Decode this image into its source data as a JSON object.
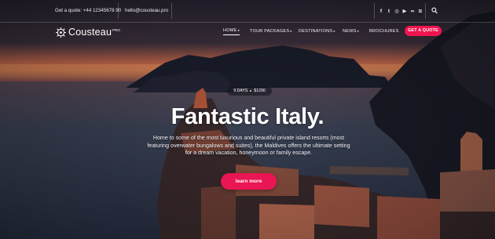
{
  "topbar": {
    "quote_phone": "Get a quote: +44 12345678 90",
    "email": "hello@cousteau.pro",
    "social_icons": [
      "facebook-icon",
      "twitter-icon",
      "instagram-icon",
      "youtube-icon",
      "flickr-icon",
      "rss-icon"
    ],
    "social_glyphs": [
      "f",
      "t",
      "◎",
      "▶",
      "∞",
      "≋"
    ]
  },
  "brand": {
    "name": "Cousteau",
    "badge": "PRO"
  },
  "nav": {
    "items": [
      {
        "label": "HOME",
        "has_dropdown": true,
        "active": true
      },
      {
        "label": "TOUR PACKAGES",
        "has_dropdown": true
      },
      {
        "label": "DESTINATIONS",
        "has_dropdown": true
      },
      {
        "label": "NEWS",
        "has_dropdown": true
      },
      {
        "label": "BROCHURES",
        "has_dropdown": false
      }
    ],
    "cta_label": "GET A QUOTE",
    "caret": "▾"
  },
  "hero": {
    "duration": "9 DAYS",
    "price": "$1290",
    "title": "Fantastic Italy.",
    "description": "Home to some of the most luxurious and beautiful private island resorts (most featuring overwater bungalows and suites), the Maldives offers the ultimate setting for a dream vacation, honeymoon or family escape.",
    "button_label": "learn more"
  },
  "colors": {
    "accent": "#F0144F",
    "topbar_text": "#E9E9EE",
    "white": "#FFFFFF"
  }
}
